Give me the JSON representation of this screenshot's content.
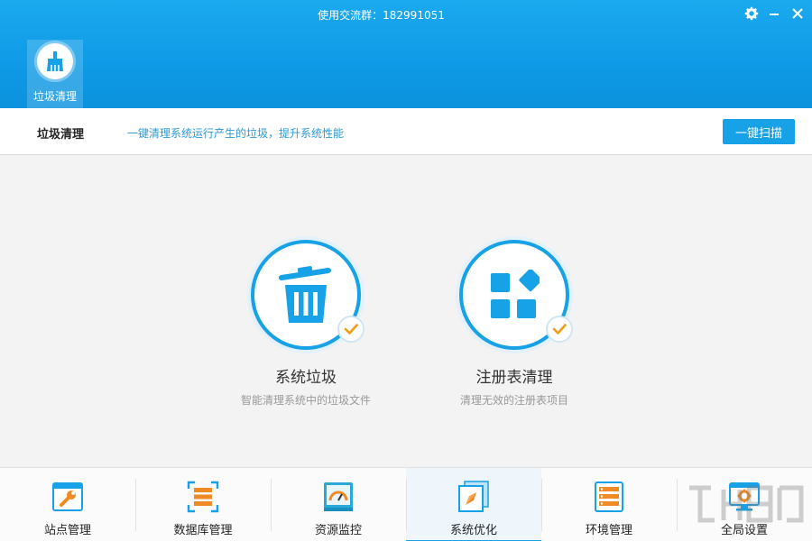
{
  "window": {
    "title": "使用交流群：182991051",
    "icons": [
      "gear-icon",
      "minimize-icon",
      "close-icon"
    ]
  },
  "header_tab": {
    "label": "垃圾清理",
    "icon": "broom-icon"
  },
  "subbar": {
    "title": "垃圾清理",
    "description": "一键清理系统运行产生的垃圾，提升系统性能",
    "scan_button": "一键扫描"
  },
  "features": [
    {
      "name": "系统垃圾",
      "description": "智能清理系统中的垃圾文件",
      "icon": "trash-icon",
      "checked": true
    },
    {
      "name": "注册表清理",
      "description": "清理无效的注册表项目",
      "icon": "registry-icon",
      "checked": true
    }
  ],
  "bottom_nav": [
    {
      "label": "站点管理",
      "icon": "site-wrench-icon",
      "active": false
    },
    {
      "label": "数据库管理",
      "icon": "database-icon",
      "active": false
    },
    {
      "label": "资源监控",
      "icon": "gauge-icon",
      "active": false
    },
    {
      "label": "系统优化",
      "icon": "optimize-icon",
      "active": true
    },
    {
      "label": "环境管理",
      "icon": "server-icon",
      "active": false
    },
    {
      "label": "全局设置",
      "icon": "monitor-gear-icon",
      "active": false
    }
  ],
  "colors": {
    "accent": "#17a1e6",
    "check": "#f39c12",
    "icon_orange": "#f08a24"
  }
}
